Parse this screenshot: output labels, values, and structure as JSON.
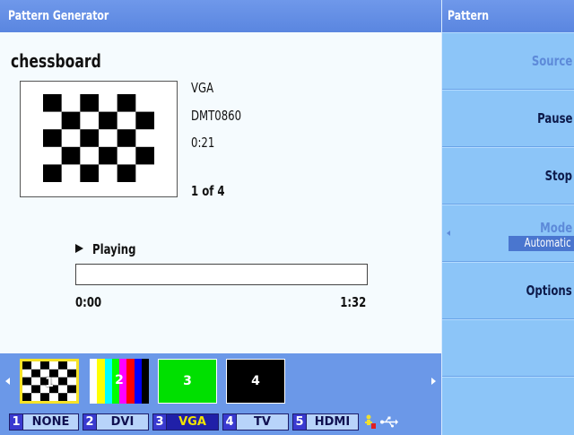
{
  "header": {
    "title": "Pattern Generator"
  },
  "pattern": {
    "name": "chessboard",
    "resolution": "VGA",
    "timing": "DMT0860",
    "duration": "0:21",
    "index_label": "1 of 4"
  },
  "playback": {
    "status": "Playing",
    "progress": 0.0,
    "start_time": "0:00",
    "end_time": "1:32"
  },
  "thumbnails": [
    {
      "number": "1",
      "selected": true,
      "icon": "chessboard-thumbnail"
    },
    {
      "number": "2",
      "selected": false,
      "icon": "colorbars-thumbnail"
    },
    {
      "number": "3",
      "selected": false,
      "icon": "green-thumbnail",
      "color": "#00e000"
    },
    {
      "number": "4",
      "selected": false,
      "icon": "black-thumbnail",
      "color": "#000000"
    }
  ],
  "sources": [
    {
      "number": "1",
      "label": "NONE",
      "selected": false
    },
    {
      "number": "2",
      "label": "DVI",
      "selected": false
    },
    {
      "number": "3",
      "label": "VGA",
      "selected": true
    },
    {
      "number": "4",
      "label": "TV",
      "selected": false
    },
    {
      "number": "5",
      "label": "HDMI",
      "selected": false
    }
  ],
  "status_icons": [
    "warning-person-icon",
    "usb-icon"
  ],
  "menu": {
    "title": "Pattern",
    "items": [
      {
        "label": "Source",
        "enabled": false
      },
      {
        "label": "Pause",
        "enabled": true
      },
      {
        "label": "Stop",
        "enabled": true
      },
      {
        "label": "Mode",
        "enabled": false,
        "value": "Automatic"
      },
      {
        "label": "Options",
        "enabled": true
      }
    ]
  },
  "colors": {
    "title_bar": "#6b98e8",
    "menu_bg": "#8cc5f8",
    "selected_highlight": "#f6e227",
    "selected_tab_text": "#f2e400"
  }
}
